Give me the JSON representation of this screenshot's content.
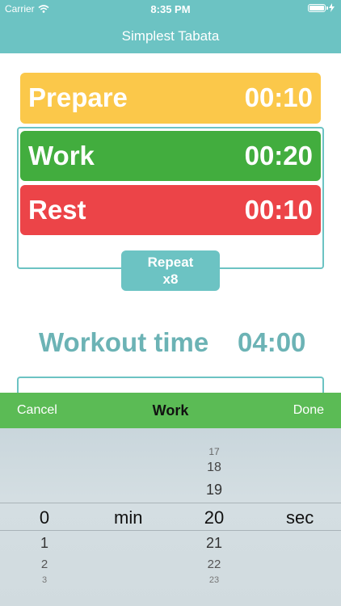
{
  "status_bar": {
    "carrier": "Carrier",
    "time": "8:35 PM"
  },
  "nav": {
    "title": "Simplest Tabata"
  },
  "intervals": {
    "prepare": {
      "label": "Prepare",
      "time": "00:10",
      "color": "#fbc84a"
    },
    "work": {
      "label": "Work",
      "time": "00:20",
      "color": "#42ad3e"
    },
    "rest": {
      "label": "Rest",
      "time": "00:10",
      "color": "#ec4448"
    }
  },
  "repeat": {
    "label": "Repeat",
    "count": "x8"
  },
  "workout": {
    "label": "Workout time",
    "time": "04:00"
  },
  "picker": {
    "cancel": "Cancel",
    "title": "Work",
    "done": "Done",
    "minutes": {
      "selected": "0",
      "below": [
        "1",
        "2",
        "3"
      ]
    },
    "min_unit": "min",
    "seconds": {
      "above": [
        "17",
        "18",
        "19"
      ],
      "selected": "20",
      "below": [
        "21",
        "22",
        "23"
      ]
    },
    "sec_unit": "sec"
  },
  "colors": {
    "accent": "#6cc3c3",
    "picker_bar": "#5bbb55"
  }
}
